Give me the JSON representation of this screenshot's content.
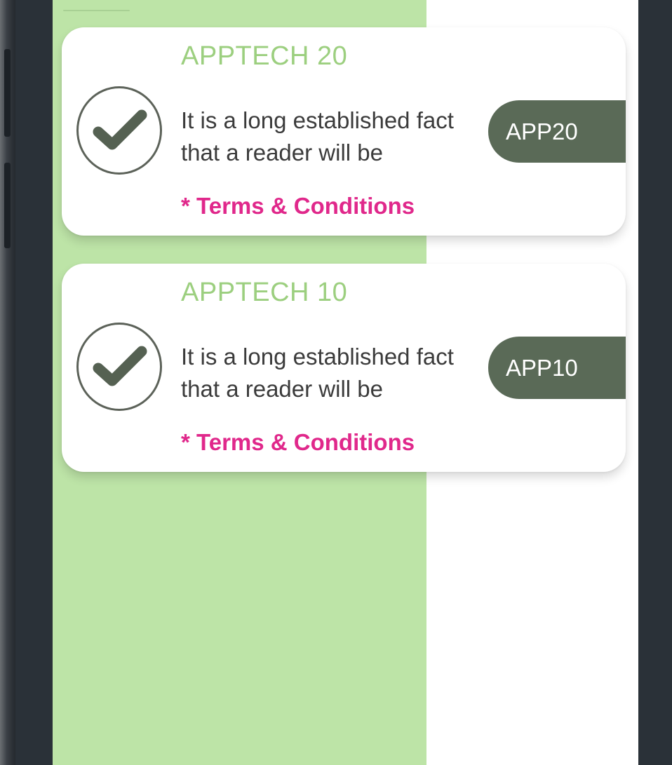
{
  "offers": [
    {
      "title": "APPTECH 20",
      "description_line1": "It is a long established fact",
      "description_line2": "that a reader will be",
      "terms": "* Terms & Conditions",
      "code": "APP20"
    },
    {
      "title": "APPTECH 10",
      "description_line1": "It is a long established fact",
      "description_line2": "that a reader will be",
      "terms": "* Terms & Conditions",
      "code": "APP10"
    }
  ],
  "colors": {
    "accent_green": "#bde4a7",
    "title_green": "#9ccf7f",
    "pill_green": "#5a6a57",
    "terms_pink": "#e0288b"
  },
  "icons": {
    "check": "check-icon"
  }
}
